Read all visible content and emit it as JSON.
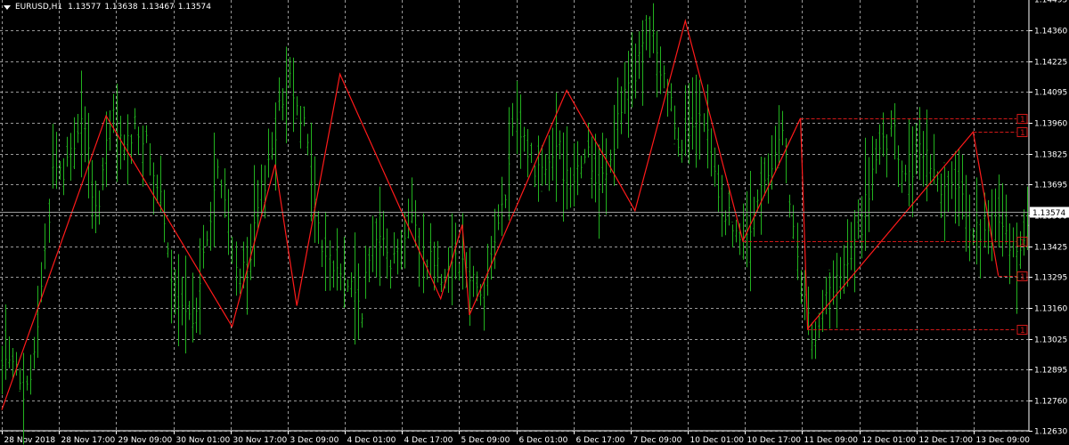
{
  "header": {
    "symbol": "EURUSD,H1",
    "open": "1.13577",
    "high": "1.13638",
    "low": "1.13467",
    "close": "1.13574"
  },
  "current_price_label": "1.13574",
  "colors": {
    "background": "#000000",
    "grid": "#bfbfbf",
    "bars": "#22b21f",
    "zigzag": "#ff1a1a",
    "levels": "#d01818",
    "text": "#ffffff",
    "price_line": "#9a9a9a"
  },
  "chart_data": {
    "type": "bar",
    "title": "EURUSD,H1",
    "ylim": [
      1.1263,
      1.1449
    ],
    "y_ticks": [
      "1.14495",
      "1.14360",
      "1.14225",
      "1.14095",
      "1.13960",
      "1.13825",
      "1.13695",
      "1.13560",
      "1.13425",
      "1.13295",
      "1.13160",
      "1.13025",
      "1.12895",
      "1.12760",
      "1.12630"
    ],
    "x_ticks": [
      "28 Nov 2018",
      "28 Nov 17:00",
      "29 Nov 09:00",
      "30 Nov 01:00",
      "30 Nov 17:00",
      "3 Dec 09:00",
      "4 Dec 01:00",
      "4 Dec 17:00",
      "5 Dec 09:00",
      "6 Dec 01:00",
      "6 Dec 17:00",
      "7 Dec 09:00",
      "10 Dec 01:00",
      "10 Dec 17:00",
      "11 Dec 09:00",
      "12 Dec 01:00",
      "12 Dec 17:00",
      "13 Dec 09:00"
    ],
    "bar_count": 286,
    "price_path": [
      1.129,
      1.13,
      1.1272,
      1.129,
      1.133,
      1.138,
      1.1372,
      1.1388,
      1.14,
      1.1352,
      1.138,
      1.14,
      1.1382,
      1.1398,
      1.1385,
      1.1375,
      1.1342,
      1.1318,
      1.1308,
      1.132,
      1.1345,
      1.1375,
      1.1355,
      1.133,
      1.133,
      1.136,
      1.138,
      1.14,
      1.1417,
      1.1405,
      1.138,
      1.1345,
      1.1336,
      1.133,
      1.1325,
      1.1315,
      1.134,
      1.1355,
      1.1335,
      1.1345,
      1.1355,
      1.134,
      1.1338,
      1.133,
      1.134,
      1.1335,
      1.133,
      1.132,
      1.1345,
      1.136,
      1.1395,
      1.1388,
      1.1375,
      1.1378,
      1.139,
      1.1372,
      1.1376,
      1.1385,
      1.137,
      1.1378,
      1.1395,
      1.141,
      1.142,
      1.144,
      1.142,
      1.141,
      1.139,
      1.139,
      1.1395,
      1.1385,
      1.136,
      1.1355,
      1.1345,
      1.135,
      1.1365,
      1.138,
      1.1395,
      1.1355,
      1.132,
      1.1305,
      1.1315,
      1.1325,
      1.133,
      1.134,
      1.1355,
      1.1375,
      1.1385,
      1.139,
      1.137,
      1.1378,
      1.1385,
      1.1372,
      1.137,
      1.1365,
      1.1358,
      1.135,
      1.1345,
      1.136,
      1.1345,
      1.134,
      1.1355
    ],
    "zigzag": [
      {
        "x": "28 Nov 2018 03:00",
        "y": 1.1272
      },
      {
        "x": "29 Nov 08:00",
        "y": 1.1399
      },
      {
        "x": "30 Nov 19:00",
        "y": 1.1308
      },
      {
        "x": "3 Dec 07:00",
        "y": 1.1378
      },
      {
        "x": "3 Dec 13:00",
        "y": 1.1317
      },
      {
        "x": "4 Dec 01:00",
        "y": 1.1417
      },
      {
        "x": "5 Dec 05:00",
        "y": 1.132
      },
      {
        "x": "5 Dec 11:00",
        "y": 1.1352
      },
      {
        "x": "5 Dec 13:00",
        "y": 1.1313
      },
      {
        "x": "6 Dec 16:00",
        "y": 1.141
      },
      {
        "x": "7 Dec 11:00",
        "y": 1.1358
      },
      {
        "x": "10 Dec 01:00",
        "y": 1.144
      },
      {
        "x": "10 Dec 17:00",
        "y": 1.1345
      },
      {
        "x": "11 Dec 09:00",
        "y": 1.1398
      },
      {
        "x": "11 Dec 11:00",
        "y": 1.1307
      },
      {
        "x": "13 Dec 09:00",
        "y": 1.1392
      },
      {
        "x": "13 Dec 16:00",
        "y": 1.133
      }
    ],
    "levels": [
      {
        "price": 1.1398,
        "label": "1"
      },
      {
        "price": 1.1392,
        "label": "1"
      },
      {
        "price": 1.1345,
        "label": "1"
      },
      {
        "price": 1.133,
        "label": "1"
      },
      {
        "price": 1.1307,
        "label": "1"
      }
    ],
    "grid": true
  }
}
